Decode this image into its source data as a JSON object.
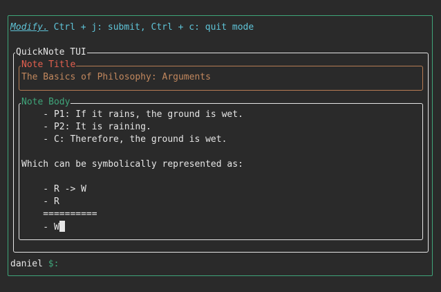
{
  "mode": {
    "name": "Modify.",
    "hint": " Ctrl + j: submit, Ctrl + c: quit mode"
  },
  "app": {
    "title": "QuickNote TUI"
  },
  "note_title": {
    "label": "Note Title",
    "value": "The Basics of Philosophy: Arguments"
  },
  "note_body": {
    "label": "Note Body",
    "lines": [
      "    - P1: If it rains, the ground is wet.",
      "    - P2: It is raining.",
      "    - C: Therefore, the ground is wet.",
      "",
      "Which can be symbolically represented as:",
      "",
      "    - R -> W",
      "    - R",
      "    ==========",
      "    - W"
    ]
  },
  "prompt": {
    "user": "daniel",
    "symbol": " $:"
  },
  "colors": {
    "background": "#2a2a2a",
    "accent_green": "#3fa57a",
    "accent_cyan": "#5fc4d8",
    "title_border": "#b87d55",
    "title_label": "#e4604f"
  }
}
